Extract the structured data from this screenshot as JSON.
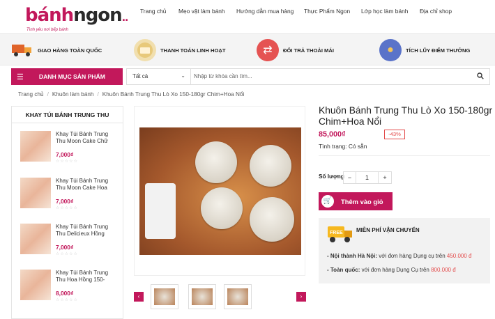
{
  "logo": {
    "part1": "bánh",
    "part2": "ngon",
    "tagline": "Tình yêu nơi bếp bánh"
  },
  "nav": [
    "Trang chủ",
    "Mẹo vặt làm bánh",
    "Hướng dẫn mua hàng",
    "Thực Phẩm Ngon",
    "Lớp học làm bánh",
    "Địa chỉ shop"
  ],
  "features": [
    {
      "label": "GIAO HÀNG TOÀN QUỐC",
      "icon": "delivery-truck-icon"
    },
    {
      "label": "THANH TOÁN LINH HOẠT",
      "icon": "payment-card-icon"
    },
    {
      "label": "ĐỔI TRẢ THOẢI MÁI",
      "icon": "return-arrows-icon"
    },
    {
      "label": "TÍCH LŨY ĐIỂM THƯỞNG",
      "icon": "piggy-bank-icon"
    }
  ],
  "category_button": "DANH MỤC SẢN PHẨM",
  "search": {
    "category": "Tất cả",
    "placeholder": "Nhập từ khóa cần tìm..."
  },
  "breadcrumb": [
    "Trang chủ",
    "Khuôn làm bánh",
    "Khuôn Bánh Trung Thu Lò Xo 150-180gr Chim+Hoa Nổi"
  ],
  "sidebar": {
    "title": "KHAY TÚI BÁNH TRUNG THU",
    "items": [
      {
        "name": "Khay Túi Bánh Trung Thu Moon Cake Chữ",
        "price": "7,000₫"
      },
      {
        "name": "Khay Túi Bánh Trung Thu Moon Cake Hoa",
        "price": "7,000₫"
      },
      {
        "name": "Khay Túi Bánh Trung Thu Delicieux Hồng",
        "price": "7,000₫"
      },
      {
        "name": "Khay Túi Bánh Trung Thu Hoa Hồng 150-",
        "price": "8,000₫"
      }
    ]
  },
  "product": {
    "title": "Khuôn Bánh Trung Thu Lò Xo 150-180gr Chim+Hoa Nổi",
    "price": "85,000₫",
    "discount": "-43%",
    "stock": "Tình trạng: Có sẵn",
    "qty_label": "Số lượng",
    "qty_value": "1",
    "add_to_cart": "Thêm vào giỏ"
  },
  "shipping": {
    "badge": "FREE",
    "title": "MIỄN PHÍ VẬN CHUYỂN",
    "line1_label": "- Nội thành Hà Nội:",
    "line1_text": " với đơn hàng Dụng cụ trên ",
    "line1_value": "450.000 đ",
    "line2_label": "- Toàn quốc:",
    "line2_text": " với đơn hàng Dụng Cụ trên ",
    "line2_value": "800.000 đ"
  },
  "colors": {
    "brand": "#c2185b",
    "discount": "#e34b4b"
  }
}
